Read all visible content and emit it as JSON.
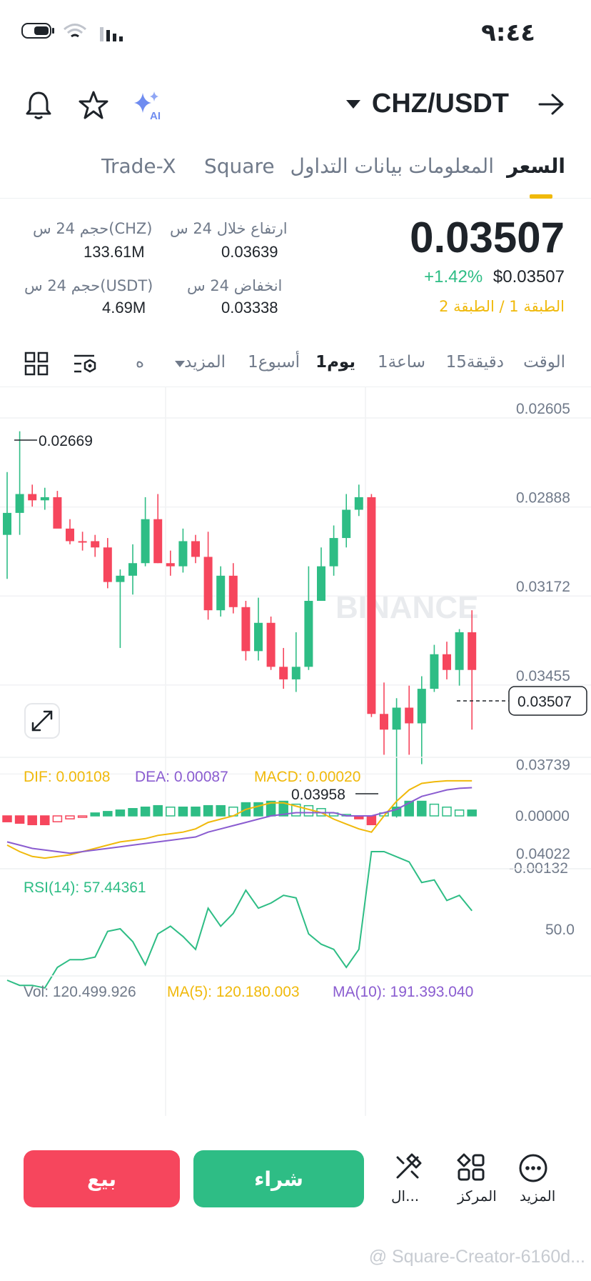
{
  "status_bar": {
    "time": "٩:٤٤"
  },
  "header": {
    "pair": "CHZ/USDT"
  },
  "tabs": [
    {
      "label": "السعر"
    },
    {
      "label": "المعلومات"
    },
    {
      "label": "بيانات التداول"
    },
    {
      "label": "Square"
    },
    {
      "label": "Trade-X"
    }
  ],
  "ticker": {
    "last_price": "0.03507",
    "change_pct": "+1.42%",
    "usd_price": "$0.03507",
    "tier": "الطبقة 1 / الطبقة 2",
    "high_label": "ارتفاع خلال 24 س",
    "high_value": "0.03639",
    "low_label": "انخفاض 24 س",
    "low_value": "0.03338",
    "vol_chz_label": "حجم 24 س(CHZ)",
    "vol_chz_value": "133.61M",
    "vol_usdt_label": "حجم 24 س(USDT)",
    "vol_usdt_value": "4.69M"
  },
  "intervals": {
    "time_label": "الوقت",
    "items": [
      "15دقيقة",
      "1ساعة",
      "1يوم",
      "1أسبوع"
    ],
    "active": "1يوم",
    "more_label": "المزيد",
    "extra_label": "ه"
  },
  "chart_data": {
    "type": "candlestick",
    "price_axis_ticks": [
      "0.02605",
      "0.02888",
      "0.03172",
      "0.03455",
      "0.03739",
      "0.04022"
    ],
    "price_axis_order": "top-to-bottom",
    "current_price_label": "0.03507",
    "marked_high_label": "0.02669",
    "marked_low_label": "0.03958",
    "watermark": "BINANCE",
    "candles_note_values_in_axis_units": [
      [
        0.03,
        0.0293,
        0.0314,
        0.028
      ],
      [
        0.0293,
        0.0287,
        0.03,
        0.0267
      ],
      [
        0.0287,
        0.0289,
        0.0291,
        0.0284
      ],
      [
        0.0289,
        0.0288,
        0.0292,
        0.0285
      ],
      [
        0.0288,
        0.0298,
        0.0291,
        0.0286
      ],
      [
        0.0298,
        0.0302,
        0.0303,
        0.0295
      ],
      [
        0.0302,
        0.0302,
        0.0305,
        0.0299
      ],
      [
        0.0302,
        0.0304,
        0.0307,
        0.03
      ],
      [
        0.0304,
        0.0315,
        0.0317,
        0.0301
      ],
      [
        0.0315,
        0.0313,
        0.0336,
        0.0311
      ],
      [
        0.0313,
        0.0309,
        0.0319,
        0.0303
      ],
      [
        0.0309,
        0.0295,
        0.031,
        0.0288
      ],
      [
        0.0295,
        0.0309,
        0.0309,
        0.0287
      ],
      [
        0.0309,
        0.031,
        0.0313,
        0.0305
      ],
      [
        0.031,
        0.0302,
        0.0312,
        0.0298
      ],
      [
        0.0302,
        0.0307,
        0.0309,
        0.03
      ],
      [
        0.0307,
        0.0324,
        0.0327,
        0.0299
      ],
      [
        0.0324,
        0.0313,
        0.0326,
        0.031
      ],
      [
        0.0313,
        0.0323,
        0.0325,
        0.0309
      ],
      [
        0.0323,
        0.0337,
        0.034,
        0.0321
      ],
      [
        0.0337,
        0.0328,
        0.034,
        0.032
      ],
      [
        0.0328,
        0.0342,
        0.0343,
        0.0326
      ],
      [
        0.0342,
        0.0346,
        0.0349,
        0.0336
      ],
      [
        0.0346,
        0.0342,
        0.035,
        0.0331
      ],
      [
        0.0342,
        0.0321,
        0.0343,
        0.031
      ],
      [
        0.0321,
        0.031,
        0.0321,
        0.0304
      ],
      [
        0.031,
        0.0301,
        0.0313,
        0.0297
      ],
      [
        0.0301,
        0.0292,
        0.0304,
        0.0287
      ],
      [
        0.0292,
        0.0288,
        0.0294,
        0.0284
      ],
      [
        0.0288,
        0.0357,
        0.0358,
        0.0287
      ],
      [
        0.0357,
        0.0362,
        0.037,
        0.0347
      ],
      [
        0.0362,
        0.0355,
        0.039,
        0.0352
      ],
      [
        0.0355,
        0.036,
        0.037,
        0.0348
      ],
      [
        0.036,
        0.0349,
        0.0373,
        0.0345
      ],
      [
        0.0349,
        0.0338,
        0.035,
        0.0335
      ],
      [
        0.0338,
        0.0343,
        0.0346,
        0.0334
      ],
      [
        0.0343,
        0.0331,
        0.0348,
        0.033
      ],
      [
        0.0331,
        0.0343,
        0.0362,
        0.0324
      ]
    ],
    "macd": {
      "dif_label": "DIF: 0.00108",
      "dea_label": "DEA: 0.00087",
      "macd_label": "MACD: 0.00020",
      "axis_ticks": [
        "0.00000",
        "-0.00132"
      ],
      "dif_color": "#f0b90b",
      "dea_color": "#8a5cd0",
      "histogram": [
        -0.0002,
        -0.00025,
        -0.0003,
        -0.0003,
        -0.0002,
        -0.0001,
        -5e-05,
        0.0001,
        0.00015,
        0.0002,
        0.00025,
        0.0003,
        0.00035,
        0.0003,
        0.0003,
        0.0003,
        0.00035,
        0.00035,
        0.0003,
        0.00045,
        0.00045,
        0.0005,
        0.0005,
        0.0004,
        0.00035,
        0.00025,
        0.0001,
        0.0,
        -0.0001,
        -0.0003,
        0.0001,
        0.0003,
        0.0005,
        0.0005,
        0.0004,
        0.0003,
        0.0002,
        0.0002
      ],
      "dif": [
        -0.0009,
        -0.0011,
        -0.00125,
        -0.0013,
        -0.00125,
        -0.0012,
        -0.0011,
        -0.001,
        -0.0009,
        -0.0008,
        -0.00075,
        -0.0007,
        -0.0006,
        -0.00055,
        -0.0005,
        -0.0004,
        -0.0002,
        -0.0001,
        0.0,
        0.0002,
        0.0003,
        0.0004,
        0.0004,
        0.0003,
        0.0002,
        0.0001,
        -0.0001,
        -0.00025,
        -0.0004,
        -0.0005,
        0.0,
        0.00045,
        0.0008,
        0.001,
        0.00105,
        0.00108,
        0.00108,
        0.00108
      ],
      "dea": [
        -0.0008,
        -0.0009,
        -0.001,
        -0.00105,
        -0.0011,
        -0.00115,
        -0.0011,
        -0.00105,
        -0.001,
        -0.00095,
        -0.0009,
        -0.00085,
        -0.0008,
        -0.00075,
        -0.0007,
        -0.00065,
        -0.0005,
        -0.0004,
        -0.0003,
        -0.0002,
        -0.0001,
        0.0,
        5e-05,
        0.0001,
        0.0001,
        0.0001,
        0.0001,
        0.0,
        0.0,
        0.0,
        0.0001,
        0.0002,
        0.0004,
        0.0006,
        0.0007,
        0.0008,
        0.00085,
        0.00087
      ]
    },
    "rsi": {
      "label": "RSI(14): 57.44361",
      "axis_ticks": [
        "50.0"
      ],
      "color": "#2ebd85",
      "values": [
        30,
        28,
        28,
        27,
        35,
        38,
        38,
        39,
        49,
        50,
        45,
        36,
        48,
        51,
        47,
        42,
        58,
        51,
        56,
        65,
        58,
        60,
        63,
        62,
        48,
        44,
        42,
        35,
        42,
        80,
        80,
        78,
        76,
        68,
        69,
        61,
        63,
        57
      ]
    },
    "volume_row": {
      "vol_label": "Vol: 120.499.926",
      "ma5_label": "MA(5): 120.180.003",
      "ma10_label": "MA(10): 191.393.040"
    },
    "colors": {
      "up": "#2ebd85",
      "down": "#f6465d"
    }
  },
  "bottom_bar": {
    "sell_label": "بيع",
    "buy_label": "شراء",
    "nav": [
      {
        "label": "المزيد",
        "icon": "more-icon"
      },
      {
        "label": "المركز",
        "icon": "grid-shapes-icon"
      },
      {
        "label": "ال...",
        "icon": "draw-tools-icon"
      }
    ]
  },
  "footer_watermark": "@ Square-Creator-6160d..."
}
